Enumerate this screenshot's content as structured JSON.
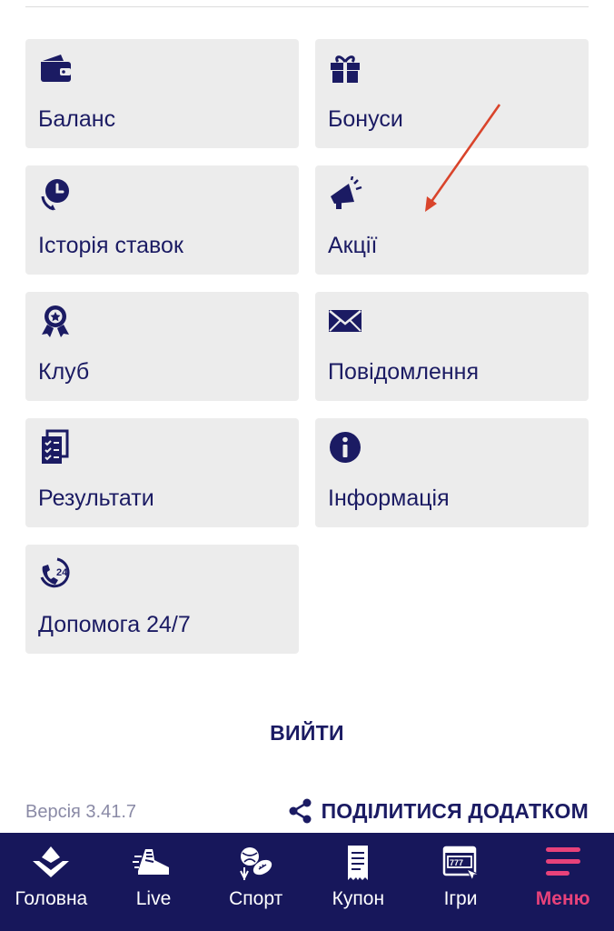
{
  "menu": {
    "tiles": [
      {
        "label": "Баланс",
        "icon": "wallet-icon"
      },
      {
        "label": "Бонуси",
        "icon": "gift-icon"
      },
      {
        "label": "Історія ставок",
        "icon": "history-icon"
      },
      {
        "label": "Акції",
        "icon": "megaphone-icon"
      },
      {
        "label": "Клуб",
        "icon": "award-badge-icon"
      },
      {
        "label": "Повідомлення",
        "icon": "envelope-icon"
      },
      {
        "label": "Результати",
        "icon": "results-clipboard-icon"
      },
      {
        "label": "Інформація",
        "icon": "info-icon"
      },
      {
        "label": "Допомога 24/7",
        "icon": "support-24-icon"
      }
    ]
  },
  "logout_label": "ВИЙТИ",
  "footer": {
    "version": "Версія 3.41.7",
    "share_label": "ПОДІЛИТИСЯ ДОДАТКОМ",
    "share_icon": "share-icon"
  },
  "bottom_nav": {
    "items": [
      {
        "label": "Головна",
        "icon": "home-logo-icon"
      },
      {
        "label": "Live",
        "icon": "running-shoe-icon"
      },
      {
        "label": "Спорт",
        "icon": "sports-balls-icon"
      },
      {
        "label": "Купон",
        "icon": "coupon-receipt-icon"
      },
      {
        "label": "Ігри",
        "icon": "slot-machine-icon"
      },
      {
        "label": "Меню",
        "icon": "hamburger-menu-icon"
      }
    ],
    "active": "Меню"
  },
  "colors": {
    "brand_navy": "#1b1b63",
    "navbar_bg": "#17175b",
    "tile_bg": "#ececec",
    "active_accent": "#e8427a",
    "annotation_arrow": "#d9442b"
  }
}
